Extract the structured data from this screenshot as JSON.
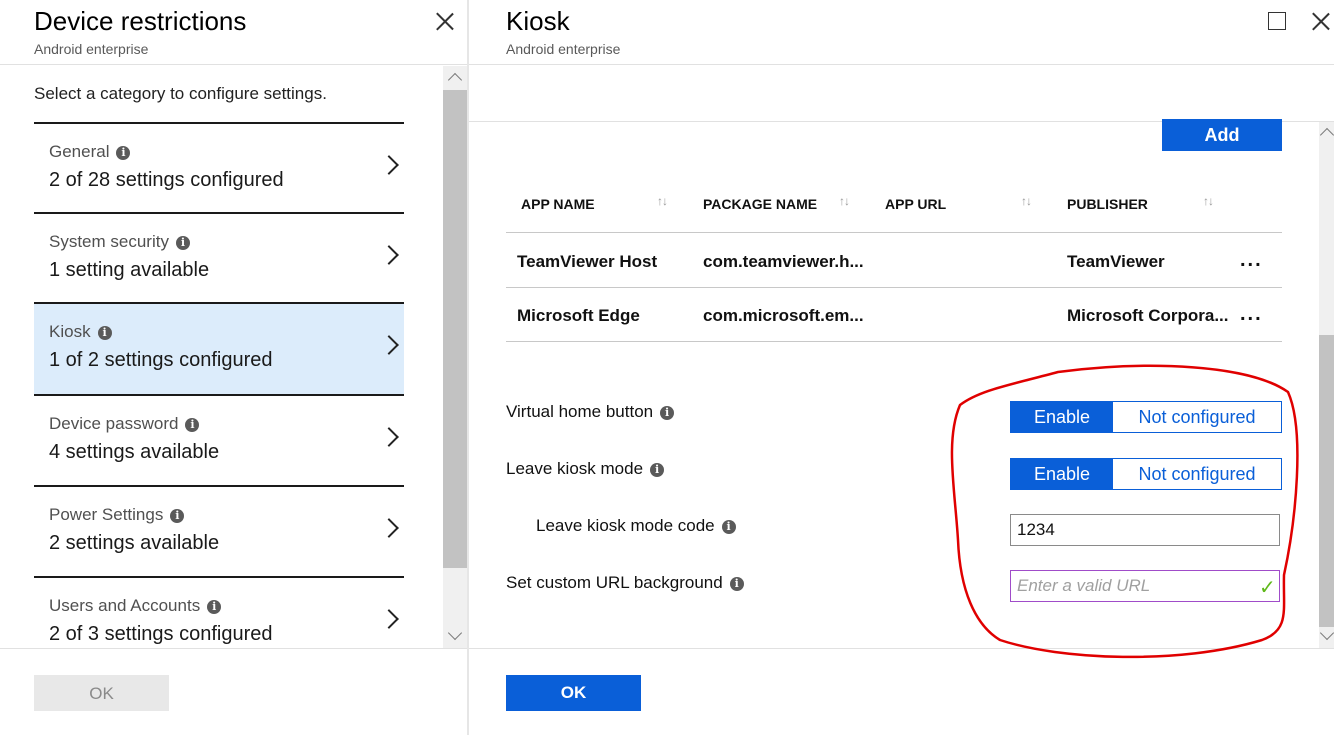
{
  "left_blade": {
    "title": "Device restrictions",
    "subtitle": "Android enterprise",
    "prompt": "Select a category to configure settings.",
    "categories": [
      {
        "name": "General",
        "status": "2 of 28 settings configured"
      },
      {
        "name": "System security",
        "status": "1 setting available"
      },
      {
        "name": "Kiosk",
        "status": "1 of 2 settings configured"
      },
      {
        "name": "Device password",
        "status": "4 settings available"
      },
      {
        "name": "Power Settings",
        "status": "2 settings available"
      },
      {
        "name": "Users and Accounts",
        "status": "2 of 3 settings configured"
      }
    ],
    "selected_category": "Kiosk",
    "ok_label": "OK"
  },
  "right_blade": {
    "title": "Kiosk",
    "subtitle": "Android enterprise",
    "add_label": "Add",
    "table": {
      "headers": [
        "APP NAME",
        "PACKAGE NAME",
        "APP URL",
        "PUBLISHER"
      ],
      "sort_glyph": "↑↓",
      "rows": [
        {
          "app_name": "TeamViewer Host",
          "package": "com.teamviewer.h...",
          "url": "",
          "publisher": "TeamViewer",
          "more": "..."
        },
        {
          "app_name": "Microsoft Edge",
          "package": "com.microsoft.em...",
          "url": "",
          "publisher": "Microsoft Corpora...",
          "more": "..."
        }
      ]
    },
    "settings": {
      "virtual_home": {
        "label": "Virtual home button",
        "enable": "Enable",
        "not_configured": "Not configured",
        "selected": "Enable"
      },
      "leave_kiosk": {
        "label": "Leave kiosk mode",
        "enable": "Enable",
        "not_configured": "Not configured",
        "selected": "Enable"
      },
      "leave_code": {
        "label": "Leave kiosk mode code",
        "value": "1234"
      },
      "custom_url": {
        "label": "Set custom URL background",
        "placeholder": "Enter a valid URL",
        "value": ""
      }
    },
    "ok_label": "OK"
  },
  "colors": {
    "accent": "#0a5fd8",
    "selected_row": "#dcecfb",
    "annotation_red": "#e00000",
    "valid_check": "#5fb81a"
  }
}
